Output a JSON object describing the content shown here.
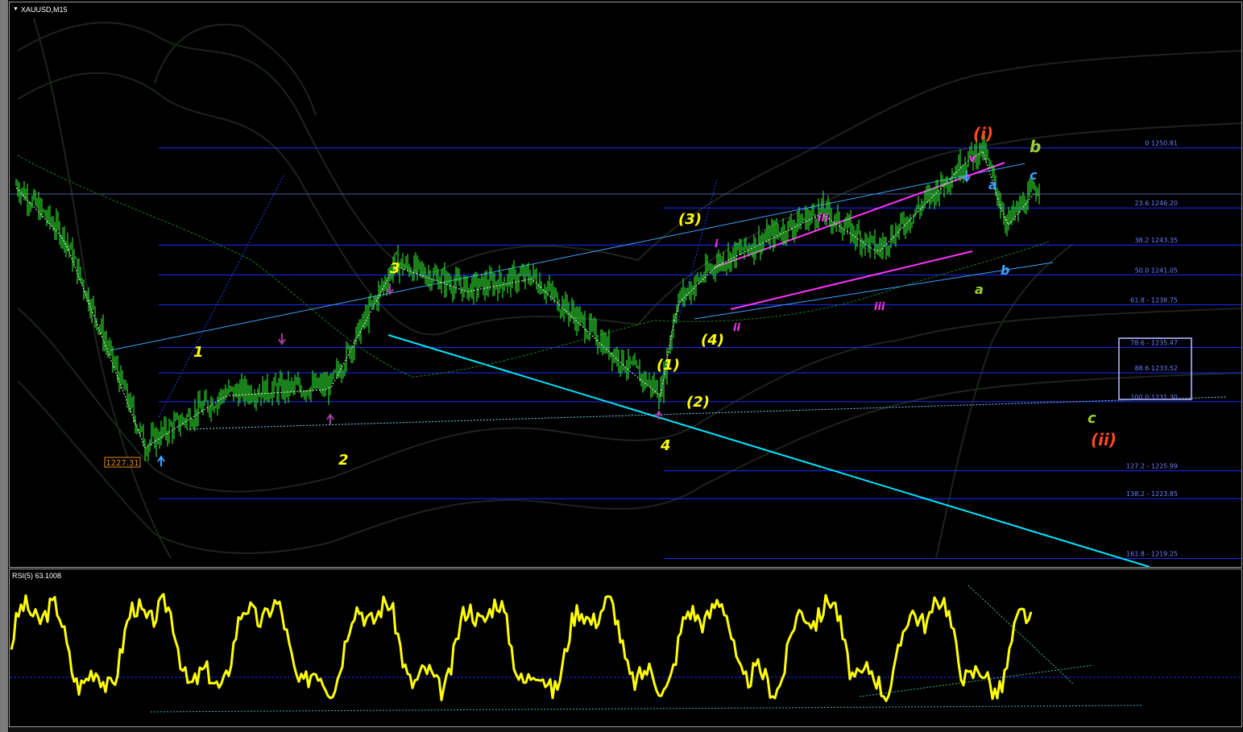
{
  "window": {
    "symbol_title": "XAUUSD,M15",
    "rsi_title": "RSI(5) 63.1008",
    "collapse_icon": "triangle-down-icon"
  },
  "chart_data": [
    {
      "type": "line",
      "name": "price",
      "title": "XAUUSD,M15",
      "x": [
        0,
        60,
        160,
        260,
        390,
        470,
        560,
        640,
        760,
        800,
        820,
        870,
        1000,
        1070,
        1180,
        1200,
        1230,
        1270
      ],
      "y": [
        1248,
        1244,
        1228,
        1232,
        1232.5,
        1242,
        1240,
        1241,
        1234,
        1232,
        1239,
        1242,
        1246,
        1243,
        1250,
        1250.8,
        1245,
        1248
      ],
      "ylim": [
        1218.6,
        1262
      ],
      "grid": false
    },
    {
      "type": "line",
      "name": "fibonacci_levels",
      "levels": [
        {
          "ratio": "0",
          "value": 1250.81,
          "label": "0 1250.81"
        },
        {
          "ratio": "23.6",
          "value": 1246.2,
          "label": "23.6 1246.20"
        },
        {
          "ratio": "38.2",
          "value": 1243.35,
          "label": "38.2 1243.35"
        },
        {
          "ratio": "50.0",
          "value": 1241.05,
          "label": "50.0 1241.05"
        },
        {
          "ratio": "61.8",
          "value": 1238.75,
          "label": "61.8 - 1238.75"
        },
        {
          "ratio": "78.6",
          "value": 1235.47,
          "label": "78.6 - 1235.47"
        },
        {
          "ratio": "88.6",
          "value": 1233.52,
          "label": "88.6 1233.52"
        },
        {
          "ratio": "100.0",
          "value": 1231.3,
          "label": "100.0 1231.30"
        },
        {
          "ratio": "127.2",
          "value": 1225.99,
          "label": "127.2 - 1225.99"
        },
        {
          "ratio": "138.2",
          "value": 1223.85,
          "label": "138.2 - 1223.85"
        },
        {
          "ratio": "161.8",
          "value": 1219.25,
          "label": "161.8 - 1219.25"
        }
      ]
    },
    {
      "type": "line",
      "name": "rsi",
      "title": "RSI(5) 63.1008",
      "current": 63.1008
    }
  ],
  "price_marker": "1227.31",
  "wave_labels": [
    {
      "text": "1",
      "color": "#ffff00"
    },
    {
      "text": "2",
      "color": "#ffff00"
    },
    {
      "text": "3",
      "color": "#ffff00"
    },
    {
      "text": "4",
      "color": "#ffff00"
    },
    {
      "text": "(1)",
      "color": "#ffff00"
    },
    {
      "text": "(2)",
      "color": "#ffff00"
    },
    {
      "text": "(3)",
      "color": "#ffff00"
    },
    {
      "text": "(4)",
      "color": "#ffff00"
    },
    {
      "text": "i",
      "color": "#ff33ff"
    },
    {
      "text": "ii",
      "color": "#ff33ff"
    },
    {
      "text": "iii",
      "color": "#ff33ff"
    },
    {
      "text": "iii",
      "color": "#ff33ff"
    },
    {
      "text": "v",
      "color": "#ff33ff"
    },
    {
      "text": "(i)",
      "color": "#ff4a1a"
    },
    {
      "text": "(ii)",
      "color": "#ff4a1a"
    },
    {
      "text": "a",
      "color": "#3da3ff"
    },
    {
      "text": "b",
      "color": "#3da3ff"
    },
    {
      "text": "c",
      "color": "#3da3ff"
    },
    {
      "text": "a",
      "color": "#9acd32"
    },
    {
      "text": "b",
      "color": "#9acd32"
    },
    {
      "text": "c",
      "color": "#9acd32"
    }
  ],
  "colors": {
    "candles": "#33ff33",
    "fib_lines": "#1a2bff",
    "channel": "#3da3ff",
    "trendline": "#00e5ff",
    "wedge": "#ff33ff",
    "rsi_line": "#ffff00",
    "background": "#000000"
  }
}
